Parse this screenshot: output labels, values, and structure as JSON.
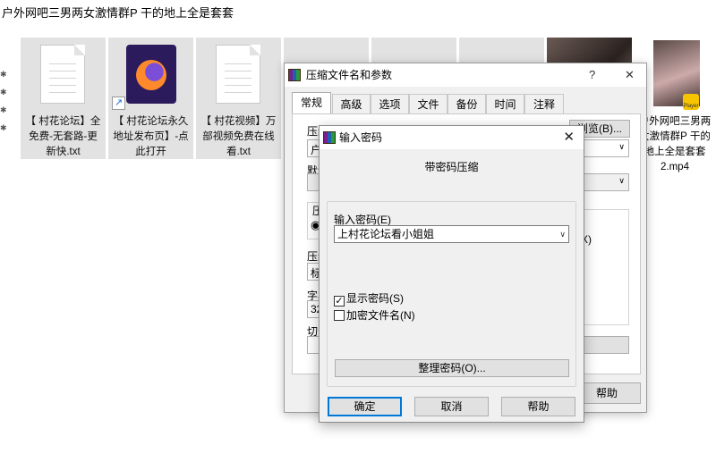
{
  "explorer": {
    "path_title": "户外网吧三男两女激情群P 干的地上全是套套",
    "files": [
      {
        "name": "【 村花论坛】全免费-无套路-更新快.txt",
        "line1": "【 村花论坛】全",
        "line2": "免费-无套路-更",
        "line3": "新快.txt",
        "icon": "text-file-icon"
      },
      {
        "name": "【 村花论坛永久地址发布页】-点此打开",
        "line1": "【 村花论坛永久",
        "line2": "地址发布页】-点",
        "line3": "此打开",
        "icon": "firefox-icon"
      },
      {
        "name": "【 村花视频】万部视频免费在线看.txt",
        "line1": "【 村花视频】万",
        "line2": "部视频免费在线",
        "line3": "看.txt",
        "icon": "text-file-icon"
      },
      {
        "name": "户外网吧三男两女激情群P 干的地上全是套套2.mp4",
        "line1": "户外网吧三男两",
        "line2": "女激情群P 干的",
        "line3": "地上全是套套",
        "line4": "2.mp4",
        "icon": "video-file-icon"
      }
    ],
    "player_badge": "Player"
  },
  "rar_dialog": {
    "title": "压缩文件名和参数",
    "help_glyph": "?",
    "close_glyph": "✕",
    "tabs": [
      "常规",
      "高级",
      "选项",
      "文件",
      "备份",
      "时间",
      "注释"
    ],
    "browse_button": "浏览(B)...",
    "help_button": "帮助",
    "fragments": {
      "archive_name_label": "压缩",
      "archive_name_value": "户",
      "default_label": "默认",
      "format_label": "压",
      "method_label": "压缩",
      "method_value": "标",
      "dict_label": "字典",
      "dict_value": "32",
      "split_label": "切分",
      "option_suffix": "X)"
    }
  },
  "password_dialog": {
    "title": "输入密码",
    "close_glyph": "✕",
    "subtitle": "带密码压缩",
    "password_label": "输入密码(E)",
    "password_value": "上村花论坛看小姐姐",
    "show_password_label": "显示密码(S)",
    "show_password_checked": true,
    "check_mark": "✓",
    "encrypt_names_label": "加密文件名(N)",
    "encrypt_names_checked": false,
    "organize_button": "整理密码(O)...",
    "ok_button": "确定",
    "cancel_button": "取消",
    "help_button": "帮助"
  }
}
